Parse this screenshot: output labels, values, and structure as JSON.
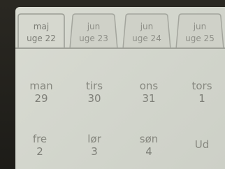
{
  "tabs": [
    {
      "month": "maj",
      "week": "uge 22",
      "active": true
    },
    {
      "month": "jun",
      "week": "uge 23",
      "active": false
    },
    {
      "month": "jun",
      "week": "uge 24",
      "active": false
    },
    {
      "month": "jun",
      "week": "uge 25",
      "active": false
    }
  ],
  "days": [
    {
      "name": "man",
      "date": "29"
    },
    {
      "name": "tirs",
      "date": "30"
    },
    {
      "name": "ons",
      "date": "31"
    },
    {
      "name": "tors",
      "date": "1"
    },
    {
      "name": "fre",
      "date": "2"
    },
    {
      "name": "lør",
      "date": "3"
    },
    {
      "name": "søn",
      "date": "4"
    }
  ],
  "exit_label": "Ud"
}
